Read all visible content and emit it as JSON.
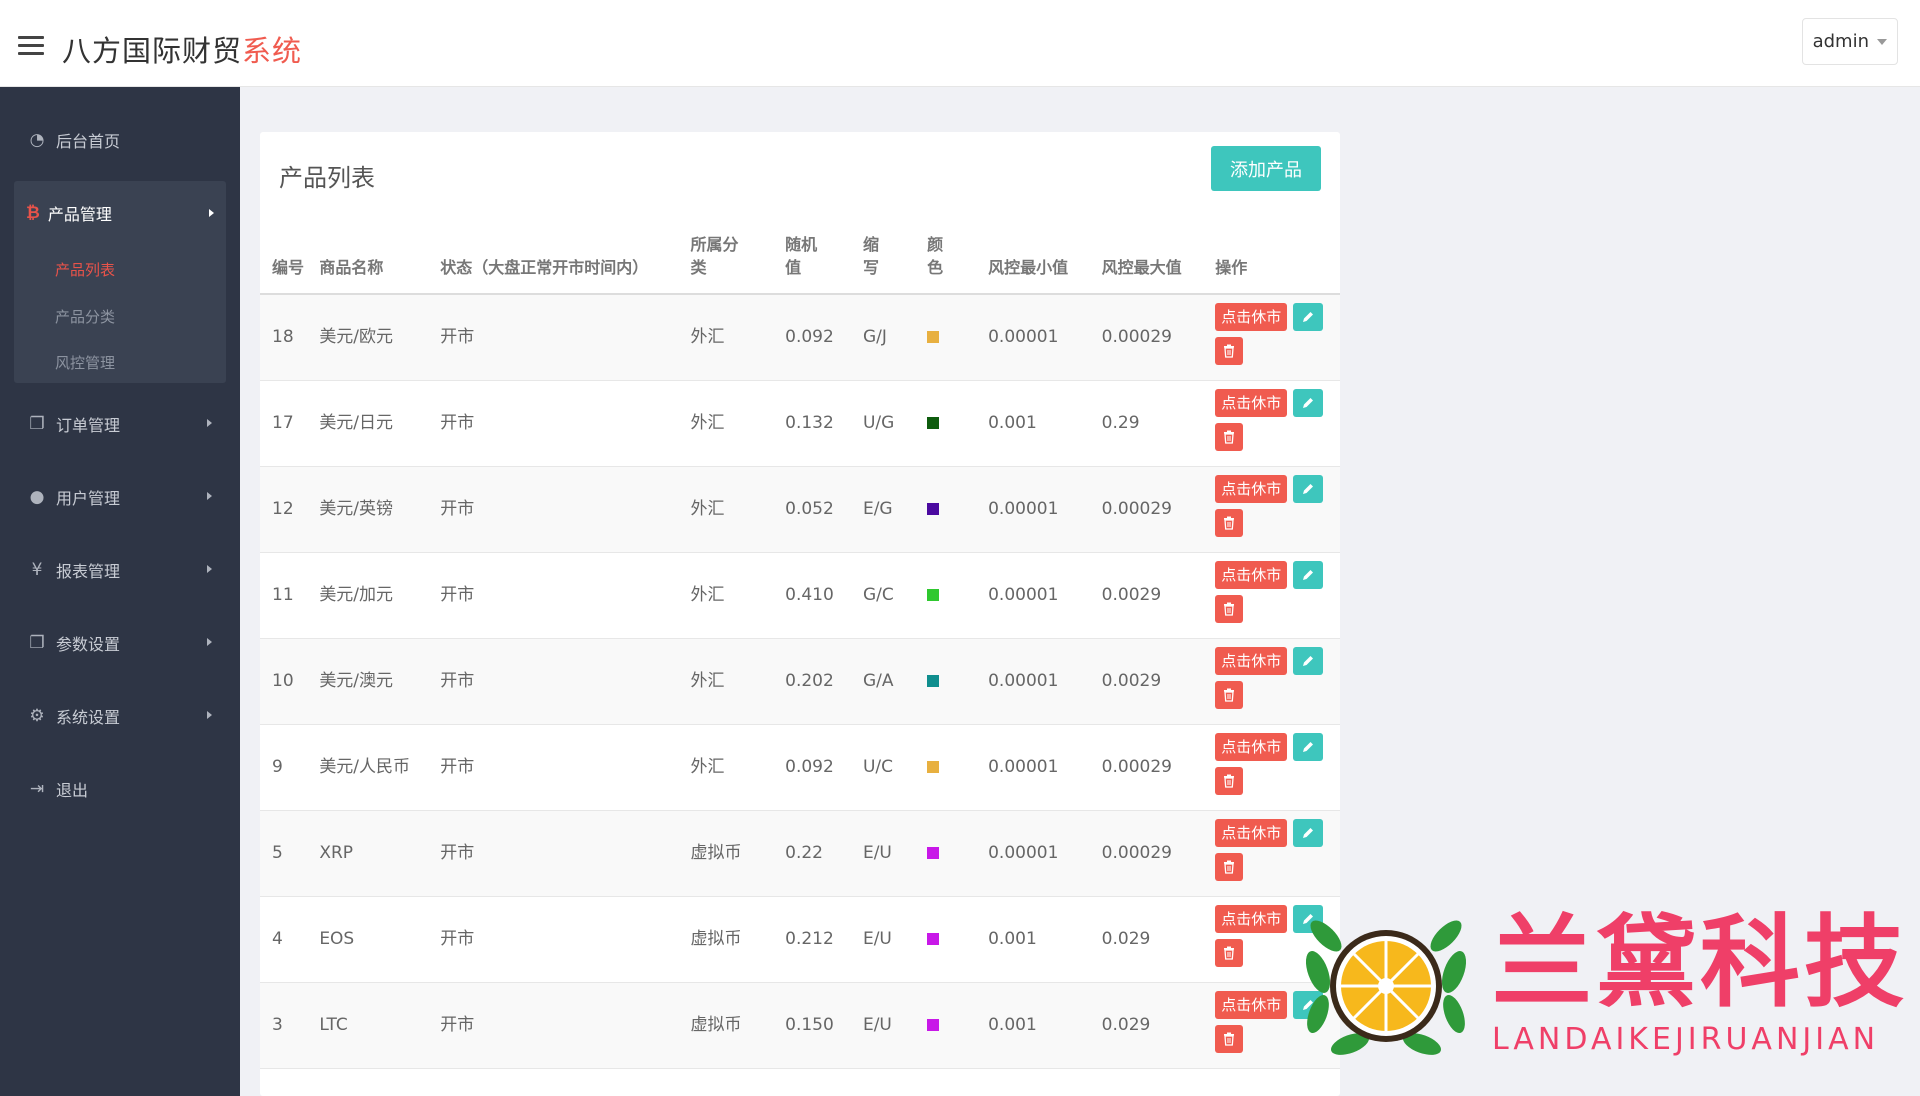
{
  "header": {
    "brand_main": "八方国际财贸",
    "brand_accent": "系统",
    "user": "admin"
  },
  "sidebar": {
    "items": [
      {
        "label": "后台首页",
        "icon": "dashboard-icon"
      },
      {
        "label": "产品管理",
        "icon": "bitcoin-icon"
      },
      {
        "label": "订单管理",
        "icon": "copy-icon"
      },
      {
        "label": "用户管理",
        "icon": "user-icon"
      },
      {
        "label": "报表管理",
        "icon": "yen-icon"
      },
      {
        "label": "参数设置",
        "icon": "copy-icon"
      },
      {
        "label": "系统设置",
        "icon": "gears-icon"
      },
      {
        "label": "退出",
        "icon": "sign-out-icon"
      }
    ],
    "sub_items": [
      {
        "label": "产品列表",
        "active": true
      },
      {
        "label": "产品分类",
        "active": false
      },
      {
        "label": "风控管理",
        "active": false
      }
    ]
  },
  "main": {
    "title": "产品列表",
    "add_button": "添加产品",
    "columns": [
      "编号",
      "商品名称",
      "状态（大盘正常开市时间内）",
      "所属分类",
      "随机值",
      "缩写",
      "颜色",
      "风控最小值",
      "风控最大值",
      "操作"
    ],
    "close_label": "点击休市",
    "rows": [
      {
        "id": "18",
        "name": "美元/欧元",
        "status": "开市",
        "category": "外汇",
        "random": "0.092",
        "abbr": "G/J",
        "color": "#e8b040",
        "min": "0.00001",
        "max": "0.00029"
      },
      {
        "id": "17",
        "name": "美元/日元",
        "status": "开市",
        "category": "外汇",
        "random": "0.132",
        "abbr": "U/G",
        "color": "#0e5c0e",
        "min": "0.001",
        "max": "0.29"
      },
      {
        "id": "12",
        "name": "美元/英镑",
        "status": "开市",
        "category": "外汇",
        "random": "0.052",
        "abbr": "E/G",
        "color": "#4b0aa0",
        "min": "0.00001",
        "max": "0.00029"
      },
      {
        "id": "11",
        "name": "美元/加元",
        "status": "开市",
        "category": "外汇",
        "random": "0.410",
        "abbr": "G/C",
        "color": "#2fc82f",
        "min": "0.00001",
        "max": "0.0029"
      },
      {
        "id": "10",
        "name": "美元/澳元",
        "status": "开市",
        "category": "外汇",
        "random": "0.202",
        "abbr": "G/A",
        "color": "#108e8e",
        "min": "0.00001",
        "max": "0.0029"
      },
      {
        "id": "9",
        "name": "美元/人民币",
        "status": "开市",
        "category": "外汇",
        "random": "0.092",
        "abbr": "U/C",
        "color": "#e8b040",
        "min": "0.00001",
        "max": "0.00029"
      },
      {
        "id": "5",
        "name": "XRP",
        "status": "开市",
        "category": "虚拟币",
        "random": "0.22",
        "abbr": "E/U",
        "color": "#c818e8",
        "min": "0.00001",
        "max": "0.00029"
      },
      {
        "id": "4",
        "name": "EOS",
        "status": "开市",
        "category": "虚拟币",
        "random": "0.212",
        "abbr": "E/U",
        "color": "#c818e8",
        "min": "0.001",
        "max": "0.029"
      },
      {
        "id": "3",
        "name": "LTC",
        "status": "开市",
        "category": "虚拟币",
        "random": "0.150",
        "abbr": "E/U",
        "color": "#c818e8",
        "min": "0.001",
        "max": "0.029"
      }
    ]
  },
  "watermark": {
    "title": "兰黛科技",
    "subtitle": "LANDAIKEJIRUANJIAN"
  }
}
